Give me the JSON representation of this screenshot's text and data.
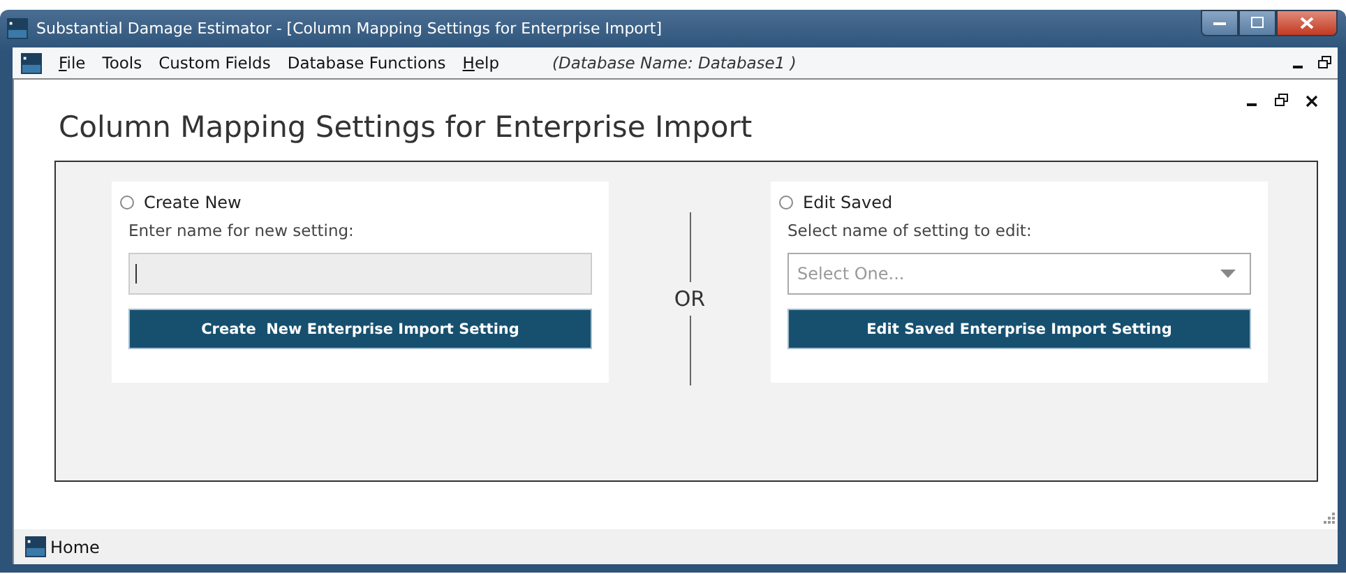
{
  "window": {
    "title": "Substantial Damage Estimator - [Column Mapping Settings for Enterprise Import]"
  },
  "menu": {
    "items": [
      {
        "label": "File",
        "mnemonic": true
      },
      {
        "label": "Tools"
      },
      {
        "label": "Custom Fields"
      },
      {
        "label": "Database Functions"
      },
      {
        "label": "Help",
        "mnemonic": true
      }
    ],
    "database": "(Database Name: Database1 )"
  },
  "page": {
    "heading": "Column Mapping Settings for Enterprise Import",
    "create": {
      "option": "Create New",
      "selected": false,
      "label": "Enter name for new setting:",
      "button": "Create  New Enterprise Import Setting"
    },
    "separator": "OR",
    "edit": {
      "option": "Edit Saved",
      "selected": false,
      "label": "Select name of setting to edit:",
      "placeholder": "Select One...",
      "button": "Edit Saved Enterprise Import Setting"
    }
  },
  "status_bar": {
    "tab": "Home"
  }
}
